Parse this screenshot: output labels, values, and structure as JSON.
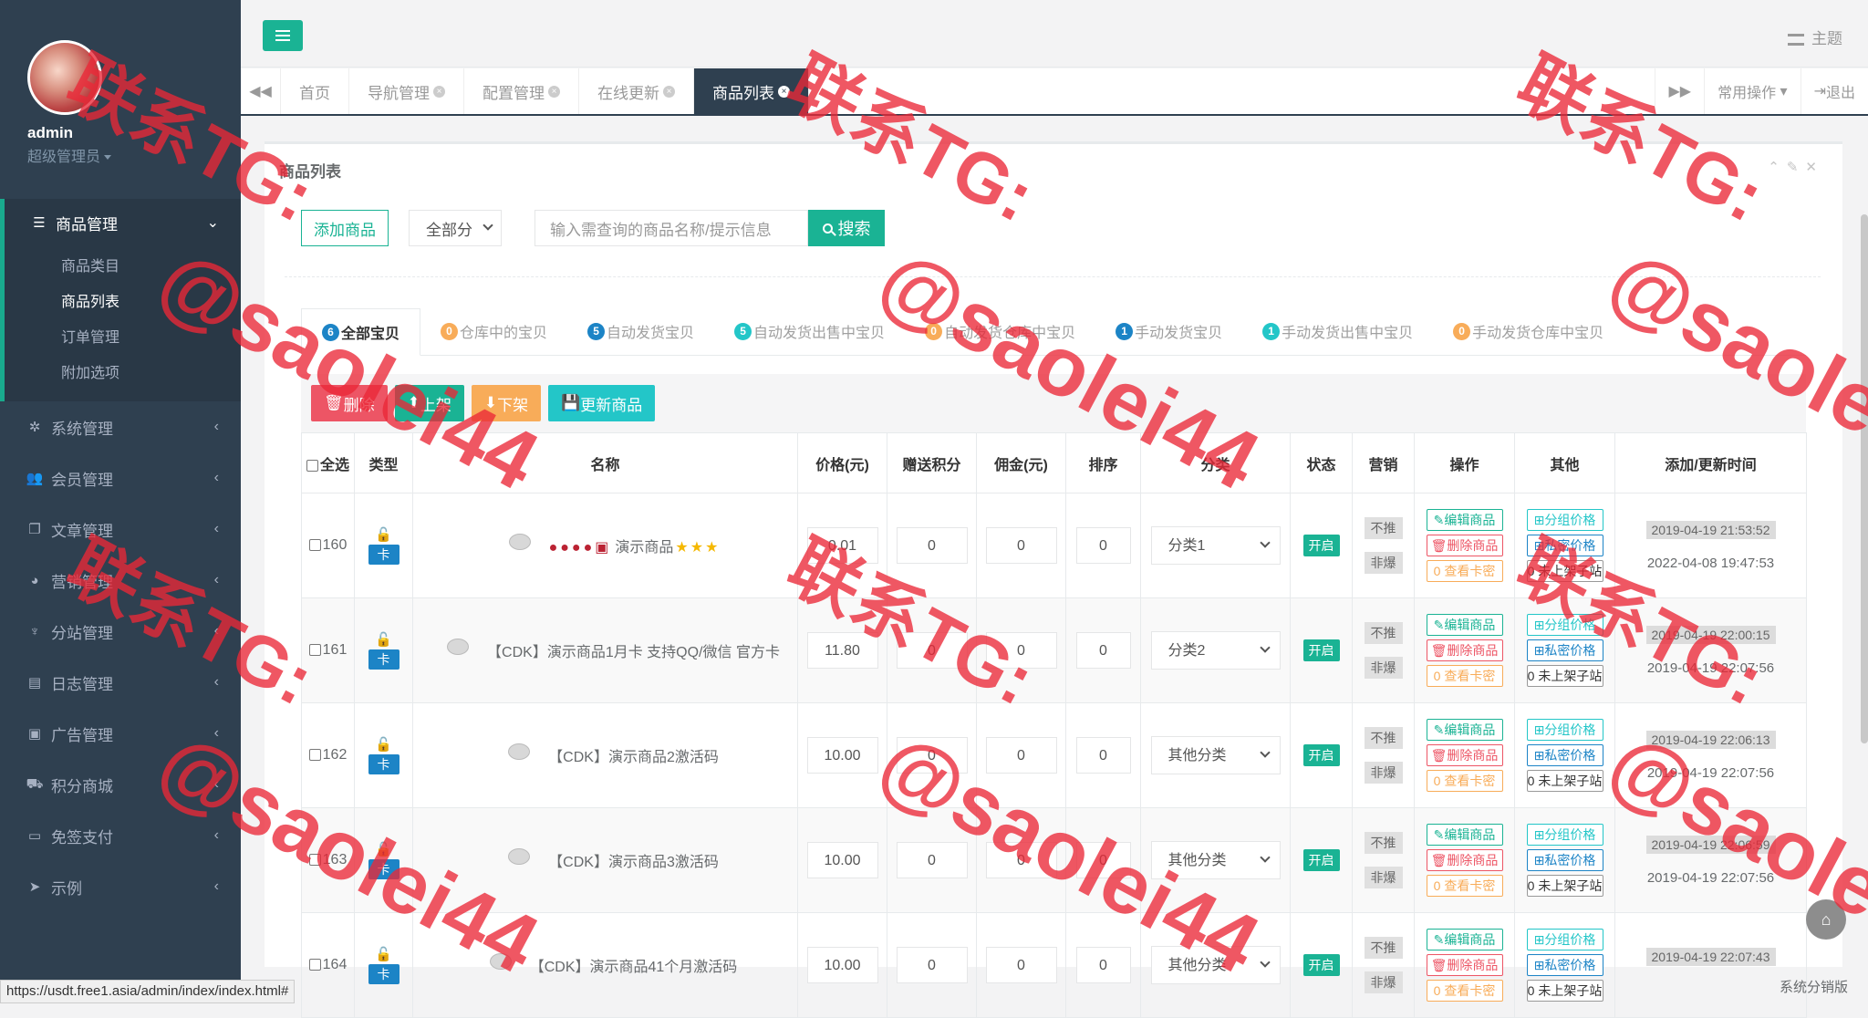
{
  "sidebar": {
    "username": "admin",
    "role": "超级管理员",
    "groups": [
      {
        "label": "商品管理",
        "icon": "list-icon",
        "sub": [
          "商品类目",
          "商品列表",
          "订单管理",
          "附加选项"
        ]
      },
      {
        "label": "系统管理",
        "icon": "gear-icon"
      },
      {
        "label": "会员管理",
        "icon": "users-icon"
      },
      {
        "label": "文章管理",
        "icon": "copy-icon"
      },
      {
        "label": "营销管理",
        "icon": "pie-chart-icon"
      },
      {
        "label": "分站管理",
        "icon": "bell-icon"
      },
      {
        "label": "日志管理",
        "icon": "log-icon"
      },
      {
        "label": "广告管理",
        "icon": "image-icon"
      },
      {
        "label": "积分商城",
        "icon": "cart-icon"
      },
      {
        "label": "免签支付",
        "icon": "credit-card-icon"
      },
      {
        "label": "示例",
        "icon": "paper-plane-icon"
      }
    ]
  },
  "topbar": {
    "theme": "主题"
  },
  "tabs": [
    {
      "label": "首页"
    },
    {
      "label": "导航管理"
    },
    {
      "label": "配置管理"
    },
    {
      "label": "在线更新"
    },
    {
      "label": "商品列表"
    }
  ],
  "tabs_right": {
    "common": "常用操作",
    "logout": "退出"
  },
  "panel": {
    "title": "商品列表",
    "add_button": "添加商品",
    "category_select": "全部分",
    "search_placeholder": "输入需查询的商品名称/提示信息",
    "search_button": "搜索"
  },
  "filter_tabs": [
    {
      "count": "6",
      "label": "全部宝贝",
      "color": "#1c84c6"
    },
    {
      "count": "0",
      "label": "仓库中的宝贝",
      "color": "#f8ac59"
    },
    {
      "count": "5",
      "label": "自动发货宝贝",
      "color": "#1c84c6"
    },
    {
      "count": "5",
      "label": "自动发货出售中宝贝",
      "color": "#23c6c8"
    },
    {
      "count": "0",
      "label": "自动发货仓库中宝贝",
      "color": "#f8ac59"
    },
    {
      "count": "1",
      "label": "手动发货宝贝",
      "color": "#1c84c6"
    },
    {
      "count": "1",
      "label": "手动发货出售中宝贝",
      "color": "#23c6c8"
    },
    {
      "count": "0",
      "label": "手动发货仓库中宝贝",
      "color": "#f8ac59"
    }
  ],
  "actions": {
    "delete": "删除",
    "up": "上架",
    "down": "下架",
    "update": "更新商品"
  },
  "columns": [
    "全选",
    "类型",
    "名称",
    "价格(元)",
    "赠送积分",
    "佣金(元)",
    "排序",
    "分类",
    "状态",
    "营销",
    "操作",
    "其他",
    "添加/更新时间"
  ],
  "row_labels": {
    "card": "卡",
    "status": "开启",
    "no_push": "不推",
    "no_hot": "非爆",
    "edit": "编辑商品",
    "delete": "删除商品",
    "view_prefix": "0",
    "view": "查看卡密",
    "group_price": "分组价格",
    "secret_price": "私密价格",
    "sub_prefix": "0",
    "sub_site": "未上架子站"
  },
  "rows": [
    {
      "id": "160",
      "name": "演示商品",
      "price": "0.01",
      "points": "0",
      "commission": "0",
      "sort": "0",
      "category": "分类1",
      "created": "2019-04-19 21:53:52",
      "updated": "2022-04-08 19:47:53"
    },
    {
      "id": "161",
      "name": "【CDK】演示商品1月卡 支持QQ/微信 官方卡",
      "price": "11.80",
      "points": "0",
      "commission": "0",
      "sort": "0",
      "category": "分类2",
      "created": "2019-04-19 22:00:15",
      "updated": "2019-04-19 22:07:56"
    },
    {
      "id": "162",
      "name": "【CDK】演示商品2激活码",
      "price": "10.00",
      "points": "0",
      "commission": "0",
      "sort": "0",
      "category": "其他分类",
      "created": "2019-04-19 22:06:13",
      "updated": "2019-04-19 22:07:56"
    },
    {
      "id": "163",
      "name": "【CDK】演示商品3激活码",
      "price": "10.00",
      "points": "0",
      "commission": "0",
      "sort": "0",
      "category": "其他分类",
      "created": "2019-04-19 22:06:59",
      "updated": "2019-04-19 22:07:56"
    },
    {
      "id": "164",
      "name": "【CDK】演示商品41个月激活码",
      "price": "10.00",
      "points": "0",
      "commission": "0",
      "sort": "0",
      "category": "其他分类",
      "created": "2019-04-19 22:07:43",
      "updated": ""
    }
  ],
  "status_url": "https://usdt.free1.asia/admin/index/index.html#",
  "footer": "系统分销版",
  "watermark": {
    "line1": "联系TG:",
    "line2": "@saolei44"
  }
}
